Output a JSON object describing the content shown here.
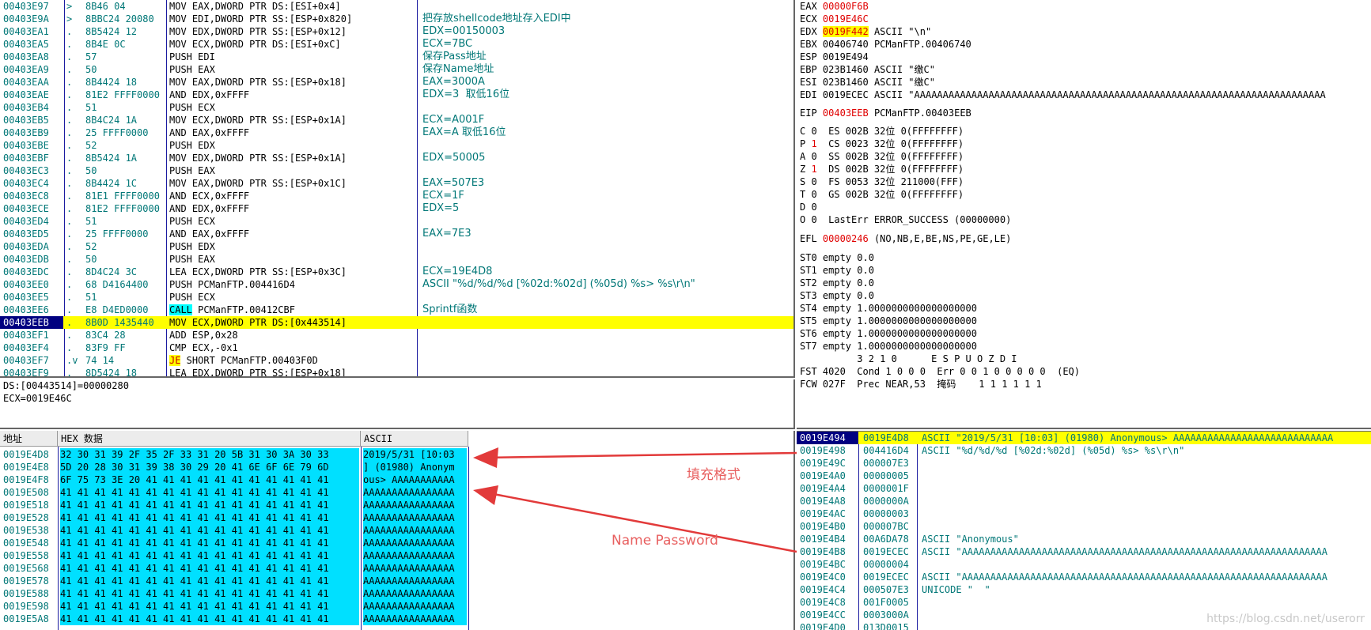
{
  "disasm": [
    {
      "addr": "00403E97",
      "m": ">",
      "hex": "8B46 04",
      "ins": "MOV EAX,DWORD PTR DS:[ESI+0x4]",
      "c": ""
    },
    {
      "addr": "00403E9A",
      "m": ">",
      "hex": "8BBC24 20080",
      "ins": "MOV EDI,DWORD PTR SS:[ESP+0x820]",
      "c": "把存放shellcode地址存入EDI中"
    },
    {
      "addr": "00403EA1",
      "m": ".",
      "hex": "8B5424 12",
      "ins": "MOV EDX,DWORD PTR SS:[ESP+0x12]",
      "c": "EDX=00150003"
    },
    {
      "addr": "00403EA5",
      "m": ".",
      "hex": "8B4E 0C",
      "ins": "MOV ECX,DWORD PTR DS:[ESI+0xC]",
      "c": "ECX=7BC"
    },
    {
      "addr": "00403EA8",
      "m": ".",
      "hex": "57",
      "ins": "PUSH EDI",
      "c": "保存Pass地址"
    },
    {
      "addr": "00403EA9",
      "m": ".",
      "hex": "50",
      "ins": "PUSH EAX",
      "c": "保存Name地址"
    },
    {
      "addr": "00403EAA",
      "m": ".",
      "hex": "8B4424 18",
      "ins": "MOV EAX,DWORD PTR SS:[ESP+0x18]",
      "c": "EAX=3000A"
    },
    {
      "addr": "00403EAE",
      "m": ".",
      "hex": "81E2 FFFF0000",
      "ins": "AND EDX,0xFFFF",
      "c": "EDX=3  取低16位"
    },
    {
      "addr": "00403EB4",
      "m": ".",
      "hex": "51",
      "ins": "PUSH ECX",
      "c": ""
    },
    {
      "addr": "00403EB5",
      "m": ".",
      "hex": "8B4C24 1A",
      "ins": "MOV ECX,DWORD PTR SS:[ESP+0x1A]",
      "c": "ECX=A001F"
    },
    {
      "addr": "00403EB9",
      "m": ".",
      "hex": "25 FFFF0000",
      "ins": "AND EAX,0xFFFF",
      "c": "EAX=A 取低16位"
    },
    {
      "addr": "00403EBE",
      "m": ".",
      "hex": "52",
      "ins": "PUSH EDX",
      "c": ""
    },
    {
      "addr": "00403EBF",
      "m": ".",
      "hex": "8B5424 1A",
      "ins": "MOV EDX,DWORD PTR SS:[ESP+0x1A]",
      "c": "EDX=50005"
    },
    {
      "addr": "00403EC3",
      "m": ".",
      "hex": "50",
      "ins": "PUSH EAX",
      "c": ""
    },
    {
      "addr": "00403EC4",
      "m": ".",
      "hex": "8B4424 1C",
      "ins": "MOV EAX,DWORD PTR SS:[ESP+0x1C]",
      "c": "EAX=507E3"
    },
    {
      "addr": "00403EC8",
      "m": ".",
      "hex": "81E1 FFFF0000",
      "ins": "AND ECX,0xFFFF",
      "c": "ECX=1F"
    },
    {
      "addr": "00403ECE",
      "m": ".",
      "hex": "81E2 FFFF0000",
      "ins": "AND EDX,0xFFFF",
      "c": "EDX=5"
    },
    {
      "addr": "00403ED4",
      "m": ".",
      "hex": "51",
      "ins": "PUSH ECX",
      "c": ""
    },
    {
      "addr": "00403ED5",
      "m": ".",
      "hex": "25 FFFF0000",
      "ins": "AND EAX,0xFFFF",
      "c": "EAX=7E3"
    },
    {
      "addr": "00403EDA",
      "m": ".",
      "hex": "52",
      "ins": "PUSH EDX",
      "c": ""
    },
    {
      "addr": "00403EDB",
      "m": ".",
      "hex": "50",
      "ins": "PUSH EAX",
      "c": ""
    },
    {
      "addr": "00403EDC",
      "m": ".",
      "hex": "8D4C24 3C",
      "ins": "LEA ECX,DWORD PTR SS:[ESP+0x3C]",
      "c": "ECX=19E4D8"
    },
    {
      "addr": "00403EE0",
      "m": ".",
      "hex": "68 D4164400",
      "ins": "PUSH PCManFTP.004416D4",
      "c": "ASCII \"%d/%d/%d [%02d:%02d] (%05d) %s> %s\\r\\n\""
    },
    {
      "addr": "00403EE5",
      "m": ".",
      "hex": "51",
      "ins": "PUSH ECX",
      "c": ""
    },
    {
      "addr": "00403EE6",
      "m": ".",
      "hex": "E8 D4ED0000",
      "ins": "CALL PCManFTP.00412CBF",
      "c": "Sprintf函数"
    },
    {
      "addr": "00403EEB",
      "m": ".",
      "hex": "8B0D 1435440",
      "ins": "MOV ECX,DWORD PTR DS:[0x443514]",
      "c": ""
    },
    {
      "addr": "00403EF1",
      "m": ".",
      "hex": "83C4 28",
      "ins": "ADD ESP,0x28",
      "c": ""
    },
    {
      "addr": "00403EF4",
      "m": ".",
      "hex": "83F9 FF",
      "ins": "CMP ECX,-0x1",
      "c": ""
    },
    {
      "addr": "00403EF7",
      "m": ".v",
      "hex": "74 14",
      "ins": "JE SHORT PCManFTP.00403F0D",
      "c": ""
    },
    {
      "addr": "00403EF9",
      "m": ".",
      "hex": "8D5424 18",
      "ins": "LEA EDX,DWORD PTR SS:[ESP+0x18]",
      "c": ""
    }
  ],
  "info": [
    "DS:[00443514]=00000280",
    "ECX=0019E46C"
  ],
  "regs": {
    "eax": {
      "name": "EAX",
      "val": "00000F6B",
      "rest": ""
    },
    "ecx": {
      "name": "ECX",
      "val": "0019E46C",
      "rest": ""
    },
    "edx": {
      "name": "EDX",
      "val": "0019F442",
      "rest": "ASCII \"\\n\""
    },
    "ebx": {
      "name": "EBX",
      "val": "00406740",
      "rest": "PCManFTP.00406740"
    },
    "esp": {
      "name": "ESP",
      "val": "0019E494",
      "rest": ""
    },
    "ebp": {
      "name": "EBP",
      "val": "023B1460",
      "rest": "ASCII \"缴C\""
    },
    "esi": {
      "name": "ESI",
      "val": "023B1460",
      "rest": "ASCII \"缴C\""
    },
    "edi": {
      "name": "EDI",
      "val": "0019ECEC",
      "rest": "ASCII \"AAAAAAAAAAAAAAAAAAAAAAAAAAAAAAAAAAAAAAAAAAAAAAAAAAAAAAAAAAAAAAAAAAAAAAAA"
    },
    "eip": {
      "name": "EIP",
      "val": "00403EEB",
      "rest": "PCManFTP.00403EEB"
    },
    "flags": [
      {
        "f": "C",
        "v": "0",
        "seg": "ES 002B 32位 0(FFFFFFFF)"
      },
      {
        "f": "P",
        "v": "1",
        "seg": "CS 0023 32位 0(FFFFFFFF)"
      },
      {
        "f": "A",
        "v": "0",
        "seg": "SS 002B 32位 0(FFFFFFFF)"
      },
      {
        "f": "Z",
        "v": "1",
        "seg": "DS 002B 32位 0(FFFFFFFF)"
      },
      {
        "f": "S",
        "v": "0",
        "seg": "FS 0053 32位 211000(FFF)"
      },
      {
        "f": "T",
        "v": "0",
        "seg": "GS 002B 32位 0(FFFFFFFF)"
      },
      {
        "f": "D",
        "v": "0",
        "seg": ""
      },
      {
        "f": "O",
        "v": "0",
        "seg": "LastErr ERROR_SUCCESS (00000000)"
      }
    ],
    "efl": {
      "name": "EFL",
      "val": "00000246",
      "rest": "(NO,NB,E,BE,NS,PE,GE,LE)"
    },
    "st": [
      "ST0 empty 0.0",
      "ST1 empty 0.0",
      "ST2 empty 0.0",
      "ST3 empty 0.0",
      "ST4 empty 1.0000000000000000000",
      "ST5 empty 1.0000000000000000000",
      "ST6 empty 1.0000000000000000000",
      "ST7 empty 1.0000000000000000000"
    ],
    "fhdr": "          3 2 1 0      E S P U O Z D I",
    "fst": "FST 4020  Cond 1 0 0 0  Err 0 0 1 0 0 0 0 0  (EQ)",
    "fcw": "FCW 027F  Prec NEAR,53  掩码    1 1 1 1 1 1"
  },
  "dump": {
    "h_addr": "地址",
    "h_hex": "HEX 数据",
    "h_ascii": "ASCII",
    "rows": [
      {
        "a": "0019E4D8",
        "h": "32 30 31 39 2F 35 2F 33 31 20 5B 31 30 3A 30 33",
        "s": "2019/5/31 [10:03"
      },
      {
        "a": "0019E4E8",
        "h": "5D 20 28 30 31 39 38 30 29 20 41 6E 6F 6E 79 6D",
        "s": "] (01980) Anonym"
      },
      {
        "a": "0019E4F8",
        "h": "6F 75 73 3E 20 41 41 41 41 41 41 41 41 41 41 41",
        "s": "ous> AAAAAAAAAAA"
      },
      {
        "a": "0019E508",
        "h": "41 41 41 41 41 41 41 41 41 41 41 41 41 41 41 41",
        "s": "AAAAAAAAAAAAAAAA"
      },
      {
        "a": "0019E518",
        "h": "41 41 41 41 41 41 41 41 41 41 41 41 41 41 41 41",
        "s": "AAAAAAAAAAAAAAAA"
      },
      {
        "a": "0019E528",
        "h": "41 41 41 41 41 41 41 41 41 41 41 41 41 41 41 41",
        "s": "AAAAAAAAAAAAAAAA"
      },
      {
        "a": "0019E538",
        "h": "41 41 41 41 41 41 41 41 41 41 41 41 41 41 41 41",
        "s": "AAAAAAAAAAAAAAAA"
      },
      {
        "a": "0019E548",
        "h": "41 41 41 41 41 41 41 41 41 41 41 41 41 41 41 41",
        "s": "AAAAAAAAAAAAAAAA"
      },
      {
        "a": "0019E558",
        "h": "41 41 41 41 41 41 41 41 41 41 41 41 41 41 41 41",
        "s": "AAAAAAAAAAAAAAAA"
      },
      {
        "a": "0019E568",
        "h": "41 41 41 41 41 41 41 41 41 41 41 41 41 41 41 41",
        "s": "AAAAAAAAAAAAAAAA"
      },
      {
        "a": "0019E578",
        "h": "41 41 41 41 41 41 41 41 41 41 41 41 41 41 41 41",
        "s": "AAAAAAAAAAAAAAAA"
      },
      {
        "a": "0019E588",
        "h": "41 41 41 41 41 41 41 41 41 41 41 41 41 41 41 41",
        "s": "AAAAAAAAAAAAAAAA"
      },
      {
        "a": "0019E598",
        "h": "41 41 41 41 41 41 41 41 41 41 41 41 41 41 41 41",
        "s": "AAAAAAAAAAAAAAAA"
      },
      {
        "a": "0019E5A8",
        "h": "41 41 41 41 41 41 41 41 41 41 41 41 41 41 41 41",
        "s": "AAAAAAAAAAAAAAAA"
      }
    ]
  },
  "stack": [
    {
      "a": "0019E494",
      "v": "0019E4D8",
      "c": "ASCII \"2019/5/31 [10:03] (01980) Anonymous> AAAAAAAAAAAAAAAAAAAAAAAAAAAA"
    },
    {
      "a": "0019E498",
      "v": "004416D4",
      "c": "ASCII \"%d/%d/%d [%02d:%02d] (%05d) %s> %s\\r\\n\""
    },
    {
      "a": "0019E49C",
      "v": "000007E3",
      "c": ""
    },
    {
      "a": "0019E4A0",
      "v": "00000005",
      "c": ""
    },
    {
      "a": "0019E4A4",
      "v": "0000001F",
      "c": ""
    },
    {
      "a": "0019E4A8",
      "v": "0000000A",
      "c": ""
    },
    {
      "a": "0019E4AC",
      "v": "00000003",
      "c": ""
    },
    {
      "a": "0019E4B0",
      "v": "000007BC",
      "c": ""
    },
    {
      "a": "0019E4B4",
      "v": "00A6DA78",
      "c": "ASCII \"Anonymous\""
    },
    {
      "a": "0019E4B8",
      "v": "0019ECEC",
      "c": "ASCII \"AAAAAAAAAAAAAAAAAAAAAAAAAAAAAAAAAAAAAAAAAAAAAAAAAAAAAAAAAAAAAAAA"
    },
    {
      "a": "0019E4BC",
      "v": "00000004",
      "c": ""
    },
    {
      "a": "0019E4C0",
      "v": "0019ECEC",
      "c": "ASCII \"AAAAAAAAAAAAAAAAAAAAAAAAAAAAAAAAAAAAAAAAAAAAAAAAAAAAAAAAAAAAAAAA"
    },
    {
      "a": "0019E4C4",
      "v": "000507E3",
      "c": "UNICODE \"  \""
    },
    {
      "a": "0019E4C8",
      "v": "001F0005",
      "c": ""
    },
    {
      "a": "0019E4CC",
      "v": "0003000A",
      "c": ""
    },
    {
      "a": "0019E4D0",
      "v": "013D0015",
      "c": ""
    }
  ],
  "annotations": {
    "fill": "填充格式",
    "namepass": "Name Password"
  },
  "watermark": "https://blog.csdn.net/userorr"
}
